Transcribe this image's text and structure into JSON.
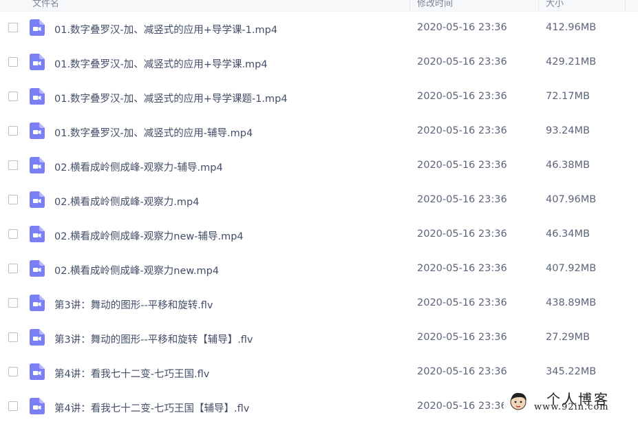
{
  "header": {
    "name_label": "文件名",
    "date_label": "修改时间",
    "size_label": "大小",
    "sort_indicator": "⌄"
  },
  "files": [
    {
      "name": "01.数字叠罗汉-加、减竖式的应用+导学课-1.mp4",
      "date": "2020-05-16 23:36",
      "size": "412.96MB"
    },
    {
      "name": "01.数字叠罗汉-加、减竖式的应用+导学课.mp4",
      "date": "2020-05-16 23:36",
      "size": "429.21MB"
    },
    {
      "name": "01.数字叠罗汉-加、减竖式的应用+导学课题-1.mp4",
      "date": "2020-05-16 23:36",
      "size": "72.17MB"
    },
    {
      "name": "01.数字叠罗汉-加、减竖式的应用-辅导.mp4",
      "date": "2020-05-16 23:36",
      "size": "93.24MB"
    },
    {
      "name": "02.横看成岭侧成峰-观察力-辅导.mp4",
      "date": "2020-05-16 23:36",
      "size": "46.38MB"
    },
    {
      "name": "02.横看成岭侧成峰-观察力.mp4",
      "date": "2020-05-16 23:36",
      "size": "407.96MB"
    },
    {
      "name": "02.横看成岭侧成峰-观察力new-辅导.mp4",
      "date": "2020-05-16 23:36",
      "size": "46.34MB"
    },
    {
      "name": "02.横看成岭侧成峰-观察力new.mp4",
      "date": "2020-05-16 23:36",
      "size": "407.92MB"
    },
    {
      "name": "第3讲：舞动的图形--平移和旋转.flv",
      "date": "2020-05-16 23:36",
      "size": "438.89MB"
    },
    {
      "name": "第3讲：舞动的图形--平移和旋转【辅导】.flv",
      "date": "2020-05-16 23:36",
      "size": "27.29MB"
    },
    {
      "name": "第4讲：看我七十二变-七巧王国.flv",
      "date": "2020-05-16 23:36",
      "size": "345.22MB"
    },
    {
      "name": "第4讲：看我七十二变-七巧王国【辅导】.flv",
      "date": "2020-05-16 23:36",
      "size": ""
    }
  ],
  "colors": {
    "video_icon": "#7b7ff5",
    "text": "#424e67",
    "checkbox_border": "#b9bec9"
  },
  "icons": {
    "file": "video-file-icon"
  },
  "watermark": {
    "title": "个人博客",
    "url": "www.92in.com"
  }
}
